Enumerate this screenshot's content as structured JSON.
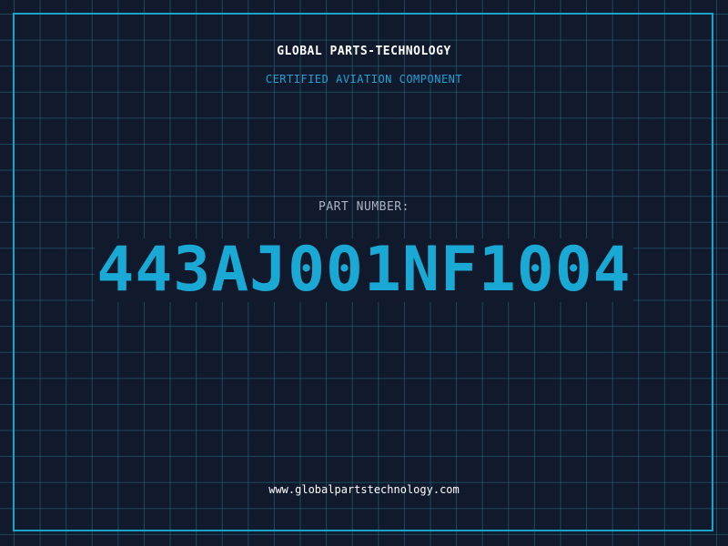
{
  "header": {
    "company": "GLOBAL PARTS-TECHNOLOGY",
    "subtitle": "CERTIFIED AVIATION COMPONENT"
  },
  "part": {
    "label": "PART NUMBER:",
    "number": "443AJ001NF1004"
  },
  "footer": {
    "website": "www.globalpartstechnology.com"
  },
  "colors": {
    "background": "#111a2c",
    "grid": "#266e82",
    "frame": "#1aa3c9",
    "accent": "#1aa8d4",
    "title": "#ffffff",
    "label": "#aab3c2"
  }
}
